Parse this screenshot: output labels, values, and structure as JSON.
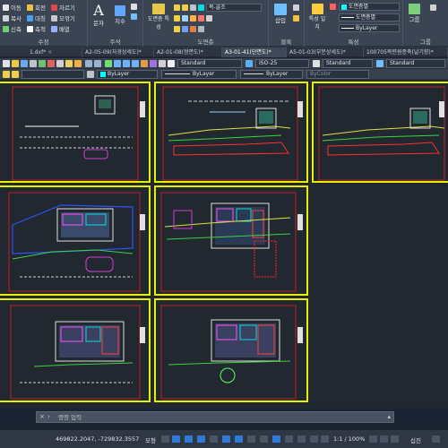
{
  "ribbon": {
    "modify_group": {
      "title": "수정",
      "rows": [
        [
          "이동",
          "회전",
          "자르기"
        ],
        [
          "복사",
          "대칭",
          "모깎기"
        ],
        [
          "신축",
          "축척",
          "배열"
        ]
      ]
    },
    "annotation_group": {
      "title": "주석",
      "text_label": "문자",
      "dim_label": "치수"
    },
    "layer_group": {
      "title": "도면층",
      "props_label": "도면층 특성"
    },
    "block_group": {
      "title": "블록",
      "insert_label": "삽입"
    },
    "properties_group": {
      "title": "특성",
      "match_label": "특성 일치",
      "color_value": "도면층별",
      "linetype_value": "도면층별",
      "lineweight_value": "ByLayer"
    },
    "groups_group": {
      "title": "그룹",
      "label": "그룹"
    },
    "layer_dropdown": "복-골조"
  },
  "tabs": [
    {
      "label": "1.dxf*",
      "active": false
    },
    {
      "label": "A2-05-09(자경상세도)*",
      "active": false
    },
    {
      "label": "A2-01-08(형면도)*",
      "active": false
    },
    {
      "label": "A3-01-41(단면도)*",
      "active": true
    },
    {
      "label": "A5-01-03(부분상세도)*",
      "active": false
    },
    {
      "label": "100705목련원종축(날기향)*",
      "active": false
    }
  ],
  "toolbar1": {
    "textstyle": "Standard",
    "dimstyle": "ISO-25",
    "tablestyle": "Standard",
    "mleaderstyle": "Standard"
  },
  "toolbar2": {
    "color": "ByLayer",
    "linetype": "ByLayer",
    "lineweight": "ByLayer",
    "plotstyle": "ByColor"
  },
  "commandline": {
    "placeholder": "명령 입력"
  },
  "status": {
    "coordinates": "469822.2047, -729832.3557",
    "model_label": "모형",
    "scale": "1:1 / 100%",
    "decimal": "십진"
  }
}
